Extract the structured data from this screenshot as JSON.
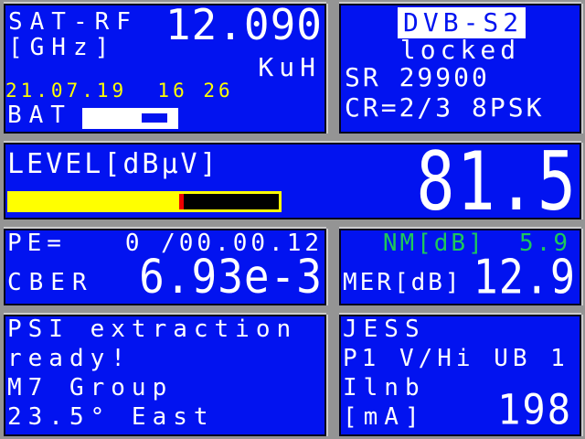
{
  "colors": {
    "panel_blue": "#0213f0",
    "panel_border": "#05051e",
    "frame_gray": "#949494",
    "text_white": "#ffffff",
    "accent_yellow": "#ffff00",
    "status_green": "#1ec85a",
    "bar_red": "#ee0000",
    "bar_black": "#000000"
  },
  "panels": {
    "sat_rf": {
      "title": "SAT-RF",
      "unit": "[GHz]",
      "frequency": "12.090",
      "band": "KuH",
      "datetime": "21.07.19  16 26",
      "battery_label": "BAT",
      "battery_mark_percent": 62
    },
    "demod": {
      "standard": "DVB-S2",
      "status": "locked",
      "symbol_rate": "SR 29900",
      "code_rate": "CR=2/3 8PSK"
    },
    "level": {
      "label": "LEVEL[dBµV]",
      "value": "81.5",
      "bar_percent": 63
    },
    "error": {
      "pe_label": "PE=",
      "pe_value": "0 /00.00.12",
      "cber_label": "CBER",
      "cber_value": "6.93e-3"
    },
    "quality": {
      "nm_line": "NM[dB]  5.9",
      "mer_label": "MER[dB]",
      "mer_value": "12.9"
    },
    "psi": {
      "lines": [
        "PSI extraction",
        "ready!",
        "M7 Group",
        "23.5° East"
      ]
    },
    "lnb": {
      "system": "JESS",
      "port_line": "P1 V/Hi UB 1",
      "current_name": "Ilnb",
      "current_unit": "[mA]",
      "current_value": "198"
    }
  }
}
